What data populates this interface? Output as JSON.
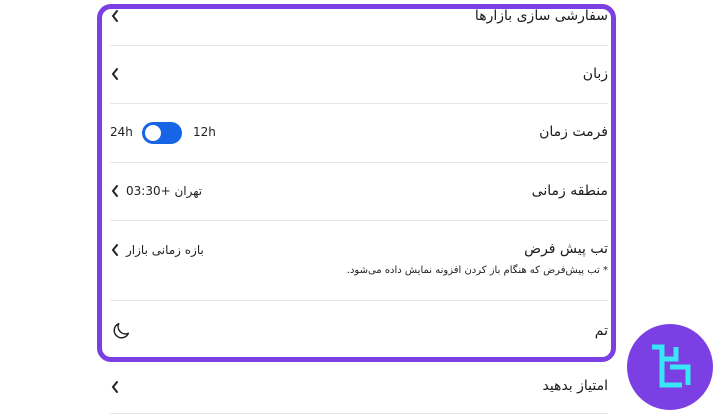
{
  "settings": {
    "customize_markets": "سفارشی سازی بازارها",
    "language": "زبان",
    "time_format": {
      "label": "فرمت زمان",
      "left": "24h",
      "right": "12h"
    },
    "timezone": {
      "label": "منطقه زمانی",
      "value": "تهران +03:30"
    },
    "default_tab": {
      "label": "تب پیش فرض",
      "value": "بازه زمانی بازار",
      "note": "* تب پیش‌فرض که هنگام باز کردن افزونه نمایش داده می‌شود."
    },
    "theme": {
      "label": "تم",
      "icon": "moon-icon"
    },
    "rate_us": "امتیاز بدهید"
  },
  "colors": {
    "accent": "#7b3fe4",
    "toggle": "#1565e6"
  }
}
